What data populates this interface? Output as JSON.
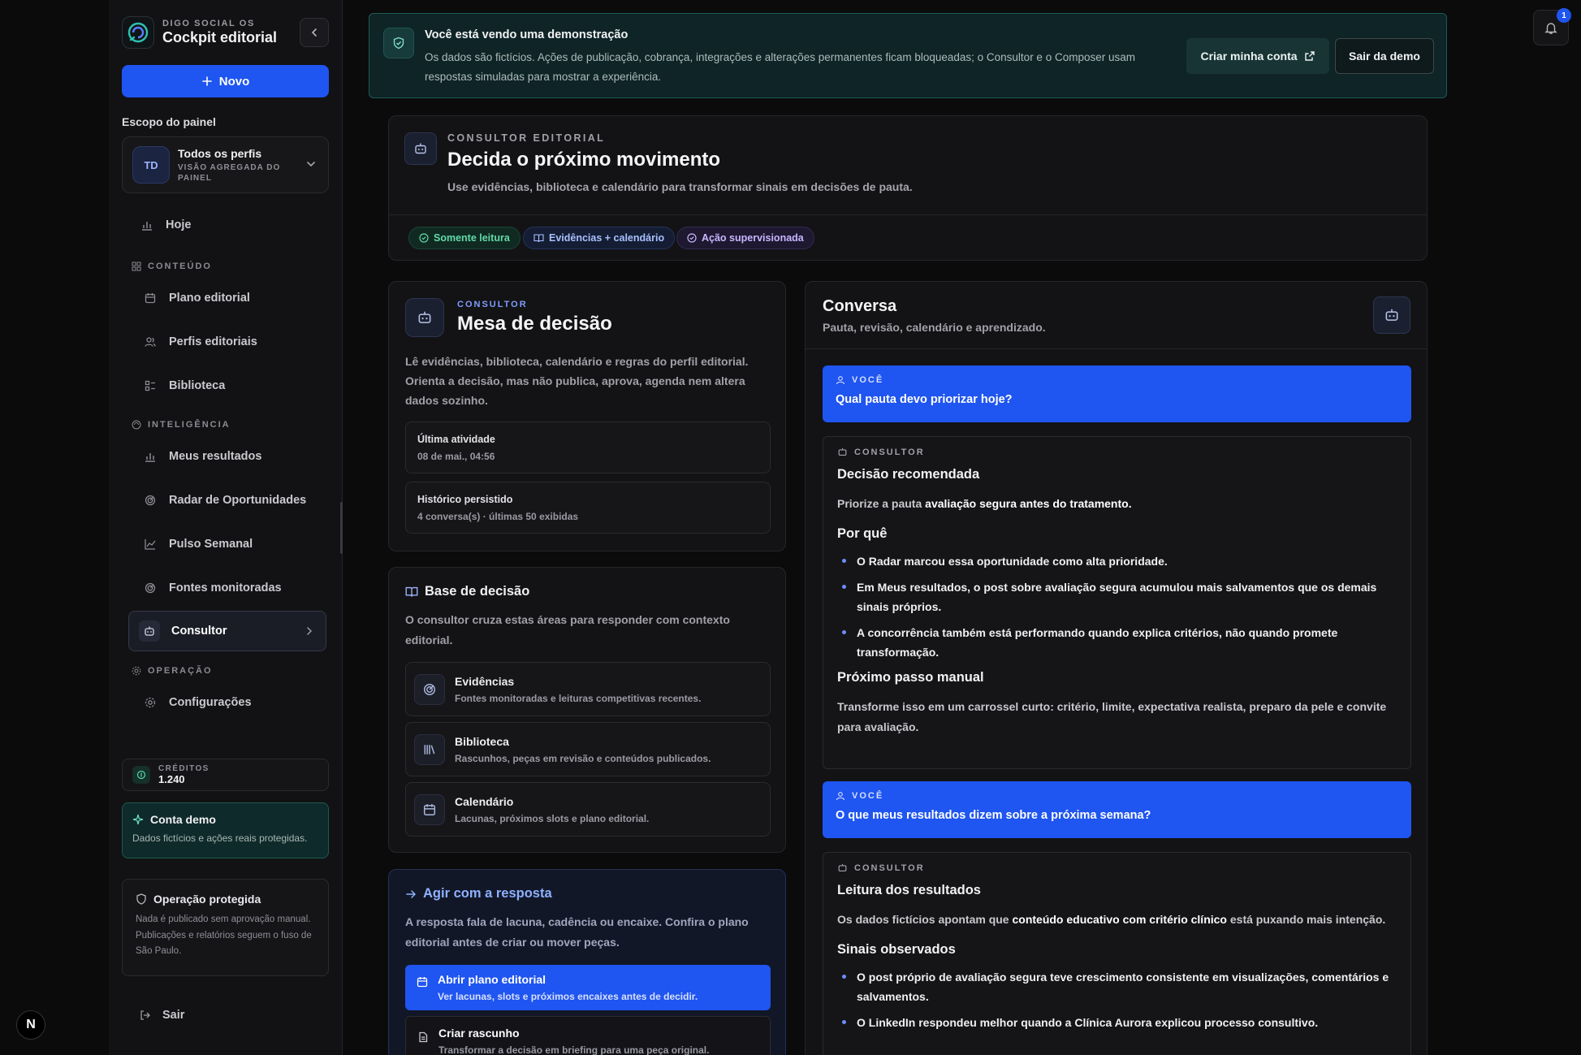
{
  "brand": {
    "kicker": "DIGO SOCIAL OS",
    "title": "Cockpit editorial"
  },
  "sidebar": {
    "new_label": "Novo",
    "scope_label": "Escopo do painel",
    "scope": {
      "initials": "TD",
      "name": "Todos os perfis",
      "sub": "VISÃO AGREGADA DO PAINEL"
    },
    "today": "Hoje",
    "sections": {
      "content": "CONTEÚDO",
      "intel": "INTELIGÊNCIA",
      "ops": "OPERAÇÃO"
    },
    "content_items": [
      "Plano editorial",
      "Perfis editoriais",
      "Biblioteca"
    ],
    "intel_items": [
      "Meus resultados",
      "Radar de Oportunidades",
      "Pulso Semanal",
      "Fontes monitoradas",
      "Consultor"
    ],
    "ops_items": [
      "Configurações"
    ],
    "credits_label": "CRÉDITOS",
    "credits_value": "1.240",
    "demo_title": "Conta demo",
    "demo_text": "Dados fictícios e ações reais protegidas.",
    "protected_title": "Operação protegida",
    "protected_text": "Nada é publicado sem aprovação manual. Publicações e relatórios seguem o fuso de São Paulo.",
    "logout": "Sair"
  },
  "banner": {
    "title": "Você está vendo uma demonstração",
    "text": "Os dados são fictícios. Ações de publicação, cobrança, integrações e alterações permanentes ficam bloqueadas; o Consultor e o Composer usam respostas simuladas para mostrar a experiência.",
    "create_label": "Criar minha conta",
    "exit_label": "Sair da demo"
  },
  "notifications": {
    "count": "1"
  },
  "header": {
    "kicker": "CONSULTOR EDITORIAL",
    "title": "Decida o próximo movimento",
    "sub": "Use evidências, biblioteca e calendário para transformar sinais em decisões de pauta.",
    "chips": [
      "Somente leitura",
      "Evidências + calendário",
      "Ação supervisionada"
    ]
  },
  "mesa": {
    "kicker": "CONSULTOR",
    "title": "Mesa de decisão",
    "text": "Lê evidências, biblioteca, calendário e regras do perfil editorial. Orienta a decisão, mas não publica, aprova, agenda nem altera dados sozinho.",
    "last_activity_label": "Última atividade",
    "last_activity_value": "08 de mai., 04:56",
    "history_label": "Histórico persistido",
    "history_value": "4 conversa(s) · últimas 50 exibidas"
  },
  "base": {
    "title": "Base de decisão",
    "text": "O consultor cruza estas áreas para responder com contexto editorial.",
    "items": [
      {
        "title": "Evidências",
        "sub": "Fontes monitoradas e leituras competitivas recentes."
      },
      {
        "title": "Biblioteca",
        "sub": "Rascunhos, peças em revisão e conteúdos publicados."
      },
      {
        "title": "Calendário",
        "sub": "Lacunas, próximos slots e plano editorial."
      }
    ]
  },
  "agir": {
    "title": "Agir com a resposta",
    "text": "A resposta fala de lacuna, cadência ou encaixe. Confira o plano editorial antes de criar ou mover peças.",
    "primary_title": "Abrir plano editorial",
    "primary_sub": "Ver lacunas, slots e próximos encaixes antes de decidir.",
    "secondary_title": "Criar rascunho",
    "secondary_sub": "Transformar a decisão em briefing para uma peça original."
  },
  "conversa": {
    "title": "Conversa",
    "sub": "Pauta, revisão, calendário e aprendizado.",
    "user_role": "VOCÊ",
    "bot_role": "CONSULTOR",
    "q1": "Qual pauta devo priorizar hoje?",
    "a1": {
      "title": "Decisão recomendada",
      "p_pre": "Priorize a pauta ",
      "p_bold": "avaliação segura antes do tratamento.",
      "why": "Por quê",
      "bullets": [
        "O Radar marcou essa oportunidade como alta prioridade.",
        "Em Meus resultados, o post sobre avaliação segura acumulou mais salvamentos que os demais sinais próprios.",
        "A concorrência também está performando quando explica critérios, não quando promete transformação."
      ],
      "next": "Próximo passo manual",
      "next_text": "Transforme isso em um carrossel curto: critério, limite, expectativa realista, preparo da pele e convite para avaliação."
    },
    "q2": "O que meus resultados dizem sobre a próxima semana?",
    "a2": {
      "title": "Leitura dos resultados",
      "p_pre": "Os dados fictícios apontam que ",
      "p_bold": "conteúdo educativo com critério clínico",
      "p_post": " está puxando mais intenção.",
      "signals": "Sinais observados",
      "bullets": [
        "O post próprio de avaliação segura teve crescimento consistente em visualizações, comentários e salvamentos.",
        "O LinkedIn respondeu melhor quando a Clínica Aurora explicou processo consultivo."
      ]
    }
  }
}
